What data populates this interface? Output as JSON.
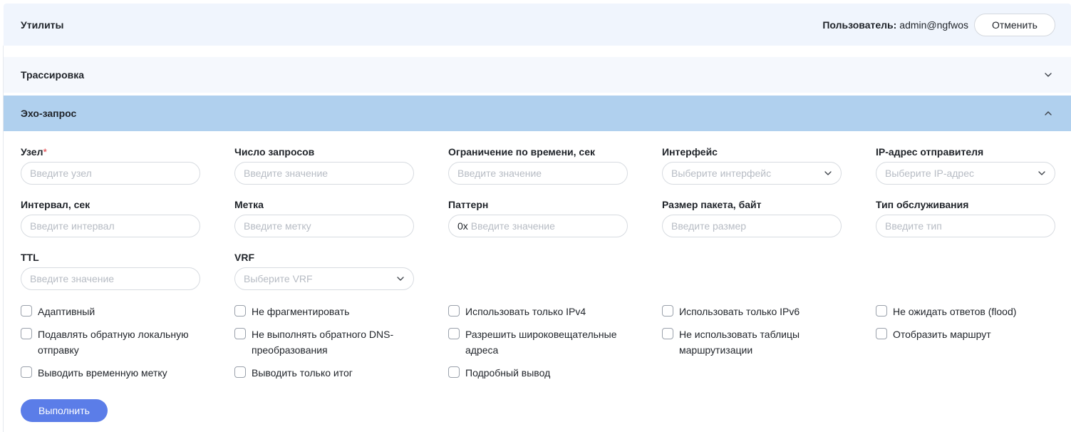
{
  "header": {
    "title": "Утилиты",
    "user_label": "Пользователь:",
    "user_value": "admin@ngfwos",
    "cancel_label": "Отменить"
  },
  "sections": {
    "trace": {
      "title": "Трассировка",
      "expanded": false
    },
    "echo": {
      "title": "Эхо-запрос",
      "expanded": true
    }
  },
  "fields": {
    "host": {
      "label": "Узел",
      "required_mark": "*",
      "placeholder": "Введите узел"
    },
    "count": {
      "label": "Число запросов",
      "placeholder": "Введите значение"
    },
    "timeout": {
      "label": "Ограничение по времени, сек",
      "placeholder": "Введите значение"
    },
    "interface": {
      "label": "Интерфейс",
      "placeholder": "Выберите интерфейс"
    },
    "source_ip": {
      "label": "IP-адрес отправителя",
      "placeholder": "Выберите IP-адрес"
    },
    "interval": {
      "label": "Интервал, сек",
      "placeholder": "Введите интервал"
    },
    "mark": {
      "label": "Метка",
      "placeholder": "Введите метку"
    },
    "pattern": {
      "label": "Паттерн",
      "prefix": "0x",
      "placeholder": "Введите значение"
    },
    "packet_size": {
      "label": "Размер пакета, байт",
      "placeholder": "Введите размер"
    },
    "tos": {
      "label": "Тип обслуживания",
      "placeholder": "Введите тип"
    },
    "ttl": {
      "label": "TTL",
      "placeholder": "Введите значение"
    },
    "vrf": {
      "label": "VRF",
      "placeholder": "Выберите VRF"
    }
  },
  "checkboxes": {
    "adaptive": {
      "label": "Адаптивный",
      "checked": false
    },
    "no_fragment": {
      "label": "Не фрагментировать",
      "checked": false
    },
    "ipv4_only": {
      "label": "Использовать только IPv4",
      "checked": false
    },
    "ipv6_only": {
      "label": "Использовать только IPv6",
      "checked": false
    },
    "flood": {
      "label": "Не ожидать ответов (flood)",
      "checked": false
    },
    "suppress_loopback": {
      "label": "Подавлять обратную локальную отправку",
      "checked": false
    },
    "no_reverse_dns": {
      "label": "Не выполнять обратного DNS-преобразования",
      "checked": false
    },
    "allow_broadcast": {
      "label": "Разрешить широковещательные адреса",
      "checked": false
    },
    "bypass_routing": {
      "label": "Не использовать таблицы маршрутизации",
      "checked": false
    },
    "record_route": {
      "label": "Отобразить маршрут",
      "checked": false
    },
    "timestamp": {
      "label": "Выводить временную метку",
      "checked": false
    },
    "summary_only": {
      "label": "Выводить только итог",
      "checked": false
    },
    "verbose": {
      "label": "Подробный вывод",
      "checked": false
    }
  },
  "run_label": "Выполнить"
}
